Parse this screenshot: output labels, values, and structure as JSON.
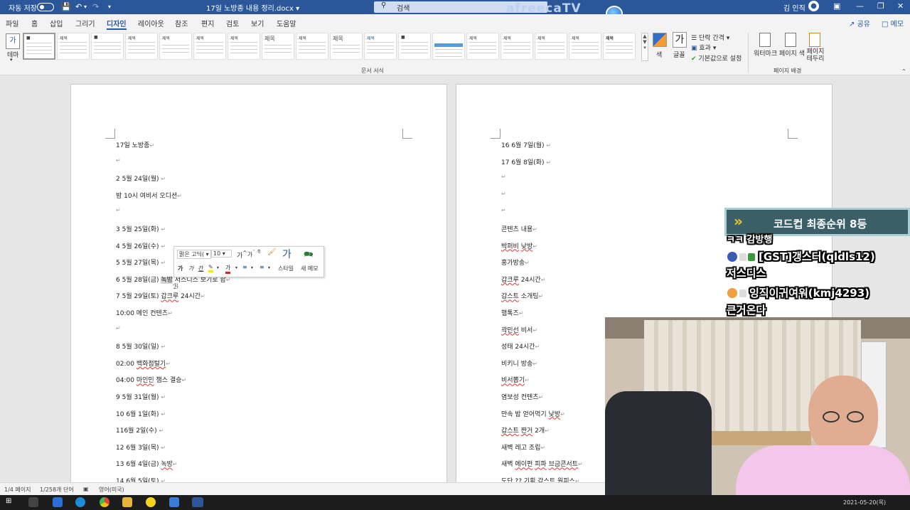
{
  "titlebar": {
    "autosave_label": "자동 저장",
    "doc_title": "17일 노방종 내용 정리.docx",
    "title_caret": "▾",
    "search_placeholder": "검색",
    "overlay_logo": "afreecaTV",
    "user_name": "김 인직"
  },
  "tabs": [
    "파일",
    "홈",
    "삽입",
    "그리기",
    "디자인",
    "레이아웃",
    "참조",
    "편지",
    "검토",
    "보기",
    "도움말"
  ],
  "active_tab": "디자인",
  "share_label": "공유",
  "memo_label": "메모",
  "ribbon": {
    "theme_label": "테마",
    "theme_icon_text": "가",
    "gallery_title_word": "제목",
    "gallery_group_label": "문서 서식",
    "color_label": "색",
    "font_label": "글꼴",
    "font_icon_text": "가",
    "paragraph_spacing_label": "단락 간격",
    "effects_label": "효과",
    "set_default_label": "기본값으로 설정",
    "watermark_label": "워터마크",
    "page_color_label": "페이지 색",
    "page_borders_label": "페이지 테두리",
    "page_bg_group_label": "페이지 배경"
  },
  "page1_lines": [
    {
      "segments": [
        {
          "text": "17일 노방종"
        }
      ]
    },
    {
      "segments": []
    },
    {
      "segments": [
        {
          "text": "2 5월 24일(월) "
        }
      ]
    },
    {
      "segments": [
        {
          "text": "밤 10시 여비서 오디션"
        }
      ]
    },
    {
      "segments": []
    },
    {
      "segments": [
        {
          "text": "3 5월 25일(화) "
        }
      ]
    },
    {
      "segments": [
        {
          "text": "4 5월 26일(수) "
        }
      ]
    },
    {
      "segments": [
        {
          "text": "5 5월 27일(목) "
        }
      ]
    },
    {
      "segments": [
        {
          "text": "6 5월 28일(금) "
        },
        {
          "text": "녹방",
          "cls": "hl"
        },
        {
          "text": "  저스디스 보기로 함"
        }
      ]
    },
    {
      "segments": [
        {
          "text": "7 5월 29일(토) "
        },
        {
          "text": "갑크루",
          "cls": "sq"
        },
        {
          "text": " 24시간"
        }
      ]
    },
    {
      "segments": [
        {
          "text": "10:00 메인 컨텐츠"
        }
      ]
    },
    {
      "segments": []
    },
    {
      "segments": [
        {
          "text": "8 5월 30일(일) "
        }
      ]
    },
    {
      "segments": [
        {
          "text": "02:00 "
        },
        {
          "text": "백화점털기",
          "cls": "sq"
        }
      ]
    },
    {
      "segments": [
        {
          "text": "04:00 "
        },
        {
          "text": "마인민",
          "cls": "sq"
        },
        {
          "text": " 챔스 결승"
        }
      ]
    },
    {
      "segments": [
        {
          "text": "9 5월 31일(월) "
        }
      ]
    },
    {
      "segments": [
        {
          "text": "10 6월 1일(화) "
        }
      ]
    },
    {
      "segments": [
        {
          "text": "116월 2일(수) "
        }
      ]
    },
    {
      "segments": [
        {
          "text": "12 6월 3일(목) "
        }
      ]
    },
    {
      "segments": [
        {
          "text": "13 6월 4일(금) "
        },
        {
          "text": "녹방",
          "cls": "sq"
        }
      ]
    },
    {
      "segments": [
        {
          "text": "14 6월 5일(토) "
        }
      ]
    }
  ],
  "page2_lines": [
    {
      "segments": [
        {
          "text": "16 6월 7일(월) "
        }
      ]
    },
    {
      "segments": [
        {
          "text": "17 6월 8일(화) "
        }
      ]
    },
    {
      "segments": []
    },
    {
      "segments": []
    },
    {
      "segments": []
    },
    {
      "segments": [
        {
          "text": "콘텐츠 내용"
        }
      ]
    },
    {
      "segments": [
        {
          "text": "박퍼비",
          "cls": "sq"
        },
        {
          "text": " "
        },
        {
          "text": "낮방",
          "cls": "sq"
        }
      ]
    },
    {
      "segments": [
        {
          "text": "홍가방송"
        }
      ]
    },
    {
      "segments": [
        {
          "text": "갑크루",
          "cls": "sq"
        },
        {
          "text": " 24시간"
        }
      ]
    },
    {
      "segments": [
        {
          "text": "갑스트",
          "cls": "sq"
        },
        {
          "text": " 소개팅"
        }
      ]
    },
    {
      "segments": [
        {
          "text": "햄톡즈"
        }
      ]
    },
    {
      "segments": [
        {
          "text": "곽민선",
          "cls": "sq"
        },
        {
          "text": " 비서"
        }
      ]
    },
    {
      "segments": [
        {
          "text": "성태 24시간"
        }
      ]
    },
    {
      "segments": [
        {
          "text": "비키니 방송"
        }
      ]
    },
    {
      "segments": [
        {
          "text": "비서뽑기",
          "cls": "sq"
        }
      ]
    },
    {
      "segments": [
        {
          "text": "염보성 컨텐츠"
        }
      ]
    },
    {
      "segments": [
        {
          "text": "만속 밥 얻어먹기 "
        },
        {
          "text": "낮방",
          "cls": "sq"
        }
      ]
    },
    {
      "segments": [
        {
          "text": "갑스트",
          "cls": "sq"
        },
        {
          "text": " "
        },
        {
          "text": "짠거",
          "cls": "sq"
        },
        {
          "text": " 2개"
        }
      ]
    },
    {
      "segments": [
        {
          "text": "새벽 레고 조립"
        }
      ]
    },
    {
      "segments": [
        {
          "text": "새벽 "
        },
        {
          "text": "에이펀",
          "cls": "sq"
        },
        {
          "text": " "
        },
        {
          "text": "피파",
          "cls": "sq"
        },
        {
          "text": " "
        },
        {
          "text": "브금콘서트",
          "cls": "sq"
        }
      ]
    },
    {
      "segments": [
        {
          "text": "도단 ?? 기획 갑스트 원피스"
        }
      ]
    }
  ],
  "minibar": {
    "font_name": "맑은 고딕(",
    "font_size": "10",
    "grow_label": "가",
    "shrink_label": "가",
    "bold_label": "가",
    "italic_label": "가",
    "underline_label": "간",
    "font_color_label": "가",
    "style_icon_text": "가",
    "styles_label": "스타일",
    "new_comment_label": "새 메모"
  },
  "statusbar": {
    "pages": "1/4 페이지",
    "words": "1/258개 단어",
    "language": "영어(미국)"
  },
  "taskbar": {
    "clock": "2021-05-20(목)"
  },
  "overlay": {
    "rank_text": "코드컵 최종순위 8등",
    "rank_chevron": "»",
    "partial_text": "ㅋㅋ 감방행",
    "chat1_user": "[GST]갱스터(qldls12)",
    "chat1_msg": "저스디스",
    "chat2_user": "잉직이귀여워(kmj4293)",
    "chat2_msg": "큰거온다"
  },
  "colors": {
    "word_blue": "#2b579a",
    "squiggle": "#d33333",
    "banner_bg": "#3b5f66",
    "banner_chevron": "#f2c531"
  }
}
